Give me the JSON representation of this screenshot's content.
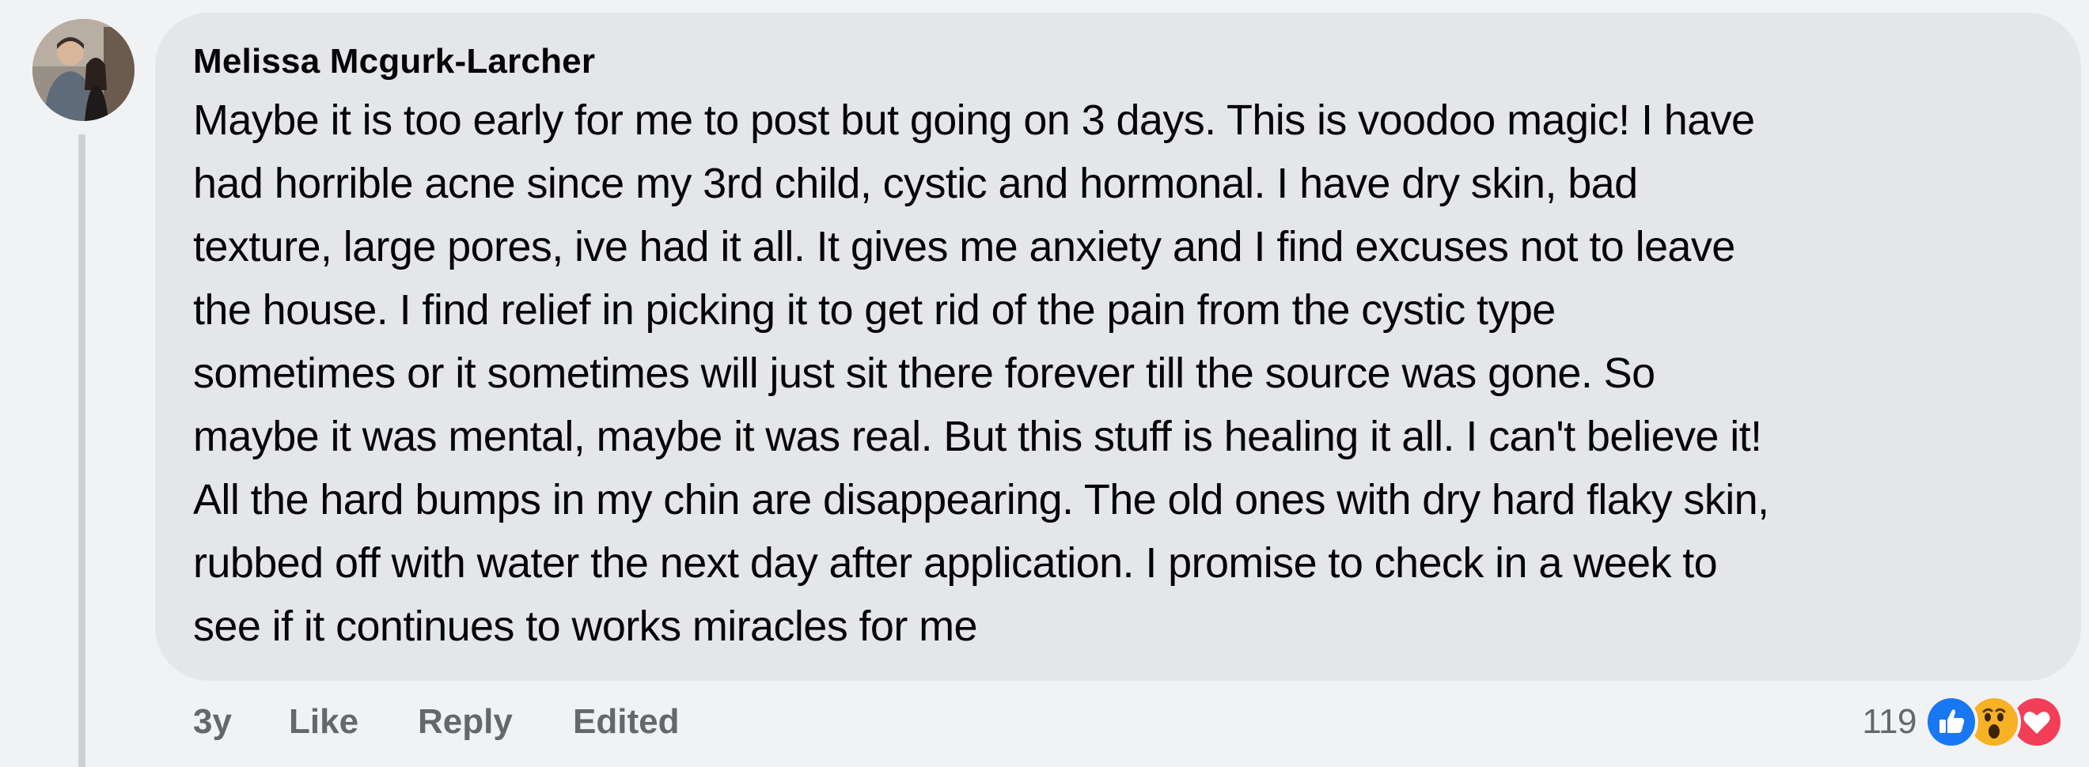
{
  "comment": {
    "author": "Melissa Mcgurk-Larcher",
    "text": "Maybe it is too early for me to post but going on 3 days. This is voodoo magic! I have\nhad horrible acne since my 3rd child, cystic and hormonal. I have dry skin, bad\ntexture, large pores, ive had it all. It gives me anxiety and I find excuses not to leave\nthe house. I find relief in picking it to get rid of the pain from the cystic type\nsometimes or it sometimes will just sit there forever till the source was gone. So\nmaybe it was mental, maybe it was real. But this stuff is healing it all. I can't believe it!\nAll the hard bumps in my chin are disappearing. The old ones with dry hard flaky skin,\nrubbed off with water the next day after application. I promise to check in a week to\nsee if it continues to works miracles for me"
  },
  "footer": {
    "time": "3y",
    "like_label": "Like",
    "reply_label": "Reply",
    "edited_label": "Edited",
    "reaction_count": "119"
  },
  "reactions": [
    {
      "icon": "like-reaction-icon",
      "color": "#1877f2"
    },
    {
      "icon": "wow-reaction-icon",
      "color": "#f7b125"
    },
    {
      "icon": "love-reaction-icon",
      "color": "#f33e58"
    }
  ],
  "colors": {
    "background": "#f1f2f4",
    "bubble": "#e4e6ea",
    "secondary_text": "#65676b",
    "primary_text": "#050505"
  }
}
